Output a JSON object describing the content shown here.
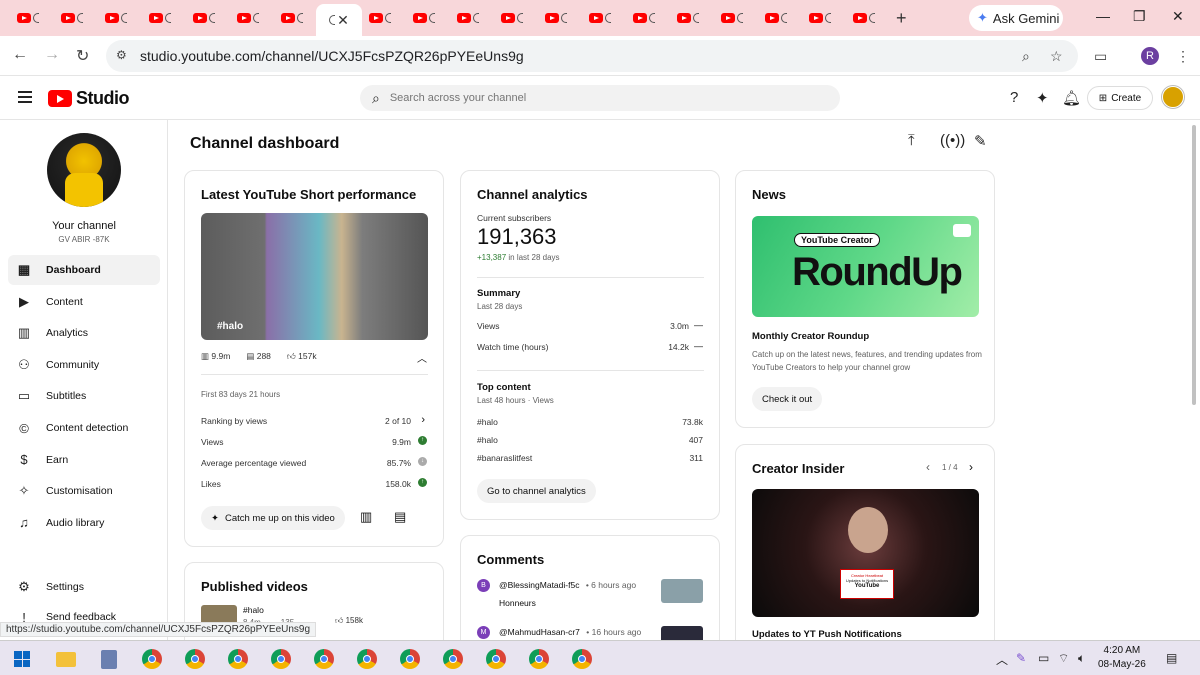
{
  "browser": {
    "tab_count": 20,
    "ask_gemini": "Ask Gemini",
    "url": "studio.youtube.com/channel/UCXJ5FcsPZQR26pPYEeUns9g",
    "profile_initial": "R",
    "status_url": "https://studio.youtube.com/channel/UCXJ5FcsPZQR26pPYEeUns9g"
  },
  "header": {
    "logo_text": "Studio",
    "search_placeholder": "Search across your channel",
    "create_label": "Create"
  },
  "sidebar": {
    "channel_label": "Your channel",
    "channel_name": "GV ABIR -87K",
    "items": [
      {
        "label": "Dashboard",
        "icon": "dashboard-icon"
      },
      {
        "label": "Content",
        "icon": "content-icon"
      },
      {
        "label": "Analytics",
        "icon": "analytics-icon"
      },
      {
        "label": "Community",
        "icon": "community-icon"
      },
      {
        "label": "Subtitles",
        "icon": "subtitles-icon"
      },
      {
        "label": "Content detection",
        "icon": "copyright-icon"
      },
      {
        "label": "Earn",
        "icon": "dollar-icon"
      },
      {
        "label": "Customisation",
        "icon": "wand-icon"
      },
      {
        "label": "Audio library",
        "icon": "audio-library-icon"
      }
    ],
    "settings": "Settings",
    "feedback": "Send feedback"
  },
  "main": {
    "title": "Channel dashboard",
    "short": {
      "heading": "Latest YouTube Short performance",
      "thumb_tag": "#halo",
      "views": "9.9m",
      "comments": "288",
      "likes": "157k",
      "period": "First 83 days 21 hours",
      "rows": [
        {
          "label": "Ranking by views",
          "value": "2 of 10"
        },
        {
          "label": "Views",
          "value": "9.9m"
        },
        {
          "label": "Average percentage viewed",
          "value": "85.7%"
        },
        {
          "label": "Likes",
          "value": "158.0k"
        }
      ],
      "catch_up": "Catch me up on this video"
    },
    "published": {
      "heading": "Published videos",
      "item_title": "#halo",
      "item_views": "8.4m",
      "item_comments": "135",
      "item_likes": "158k"
    },
    "analytics": {
      "heading": "Channel analytics",
      "subs_label": "Current subscribers",
      "subs_value": "191,363",
      "subs_change": "+13,387",
      "subs_change_suffix": "in last 28 days",
      "summary_title": "Summary",
      "summary_period": "Last 28 days",
      "summary_rows": [
        {
          "label": "Views",
          "value": "3.0m"
        },
        {
          "label": "Watch time (hours)",
          "value": "14.2k"
        }
      ],
      "top_title": "Top content",
      "top_period": "Last 48 hours · Views",
      "top_rows": [
        {
          "label": "#halo",
          "value": "73.8k"
        },
        {
          "label": "#halo",
          "value": "407"
        },
        {
          "label": "#banaraslitfest",
          "value": "311"
        }
      ],
      "go_button": "Go to channel analytics"
    },
    "comments": {
      "heading": "Comments",
      "items": [
        {
          "author": "@BlessingMatadi-f5c",
          "time": "• 6 hours ago",
          "text": "Honneurs",
          "initial": "B",
          "color": "#7b3fb8"
        },
        {
          "author": "@MahmudHasan-cr7",
          "time": "• 16 hours ago",
          "text": "",
          "initial": "M",
          "color": "#7b3fb8"
        }
      ]
    },
    "news": {
      "heading": "News",
      "img_label": "YouTube Creator",
      "img_big": "RoundUp",
      "title": "Monthly Creator Roundup",
      "desc": "Catch up on the latest news, features, and trending updates from YouTube Creators to help your channel grow",
      "button": "Check it out"
    },
    "insider": {
      "heading": "Creator Insider",
      "pager": "1 / 4",
      "sign_line1": "Creator Heartbeat",
      "sign_line2": "Updates to Notifications",
      "sign_logo": "YouTube",
      "caption": "Updates to YT Push Notifications"
    }
  },
  "taskbar": {
    "time": "4:20 AM",
    "date": "08-May-26"
  },
  "colors": {
    "brand_red": "#ff0000",
    "positive_green": "#2e7d32",
    "tabbar_pink": "#f8d7da"
  }
}
